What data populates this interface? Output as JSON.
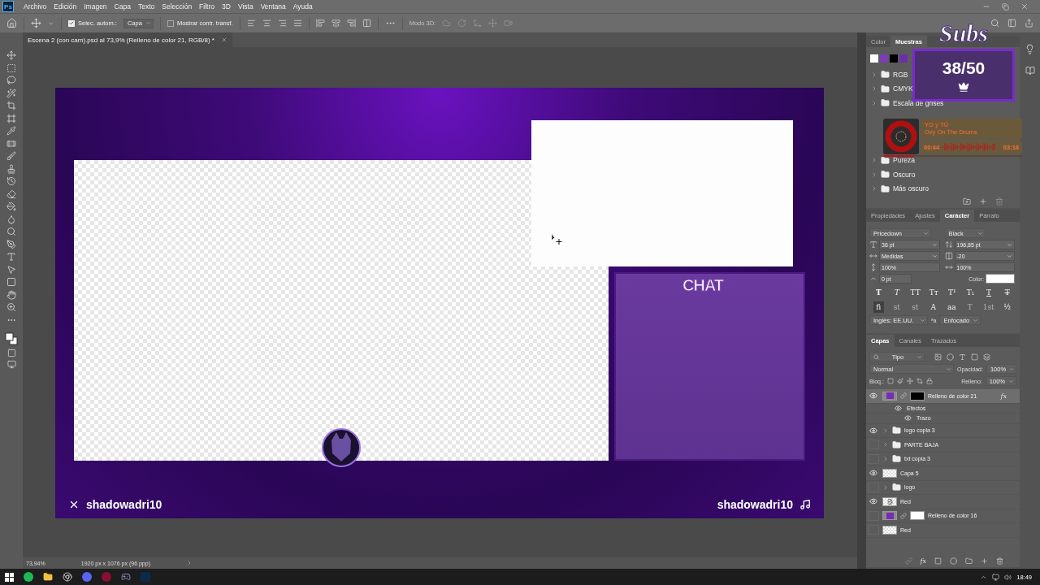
{
  "app_logo": "Ps",
  "menu": [
    "Archivo",
    "Edición",
    "Imagen",
    "Capa",
    "Texto",
    "Selección",
    "Filtro",
    "3D",
    "Vista",
    "Ventana",
    "Ayuda"
  ],
  "options_bar": {
    "auto_select": {
      "label": "Selec. autom.:",
      "checked": true
    },
    "target": "Capa",
    "show_transform": {
      "label": "Mostrar contr. transf.",
      "checked": false
    },
    "mode_3d": "Modo 3D:"
  },
  "document_tab": {
    "title": "Escena 2 (con cam).psd al 73,9% (Relleno de color 21, RGB/8) *",
    "selected": true
  },
  "canvas": {
    "chat_label": "CHAT",
    "left_handle": "shadowadri10",
    "right_handle": "shadowadri10"
  },
  "status_bar": {
    "zoom": "73,94%",
    "doc_size": "1920 px x 1076 px (96 ppp)"
  },
  "swatches_panel": {
    "tabs": [
      {
        "label": "Color",
        "selected": false
      },
      {
        "label": "Muestras",
        "selected": true
      }
    ],
    "swatches": [
      {
        "color": "#ffffff"
      },
      {
        "color": "#7b3db5"
      },
      {
        "color": "#000000"
      },
      {
        "color": "#6d2fa8"
      }
    ],
    "groups": [
      {
        "name": "RGB"
      },
      {
        "name": "CMYK"
      },
      {
        "name": "Escala de grises"
      },
      {
        "name": "Pureza"
      },
      {
        "name": "Oscuro"
      },
      {
        "name": "Más oscuro"
      }
    ]
  },
  "character_panel": {
    "tabs": [
      {
        "label": "Propiedades",
        "selected": false
      },
      {
        "label": "Ajustes",
        "selected": false
      },
      {
        "label": "Carácter",
        "selected": true
      },
      {
        "label": "Párrafo",
        "selected": false
      }
    ],
    "font": "Pricedown",
    "style": "Black",
    "size": "36 pt",
    "leading": "196,85 pt",
    "kerning": "Medidas",
    "tracking": "-20",
    "vertical_scale": "100%",
    "horizontal_scale": "100%",
    "baseline_shift": "0 pt",
    "color_label": "Color:",
    "style_buttons": [
      {
        "glyph": "T",
        "kind": "bold"
      },
      {
        "glyph": "T",
        "kind": "italic"
      },
      {
        "glyph": "TT",
        "kind": "caps"
      },
      {
        "glyph": "Tт",
        "kind": "smallcaps"
      },
      {
        "glyph": "T¹",
        "kind": "super"
      },
      {
        "glyph": "T₁",
        "kind": "sub"
      },
      {
        "glyph": "T",
        "kind": "underline"
      },
      {
        "glyph": "T",
        "kind": "strike"
      }
    ],
    "opentype_buttons": [
      {
        "glyph": "fi",
        "selected": true,
        "disabled": false
      },
      {
        "glyph": "st",
        "selected": false,
        "disabled": true
      },
      {
        "glyph": "st",
        "selected": false,
        "disabled": true
      },
      {
        "glyph": "A",
        "selected": false,
        "disabled": false
      },
      {
        "glyph": "aa",
        "selected": false,
        "disabled": false
      },
      {
        "glyph": "T",
        "selected": false,
        "disabled": true
      },
      {
        "glyph": "1st",
        "selected": false,
        "disabled": true
      },
      {
        "glyph": "½",
        "selected": false,
        "disabled": false
      }
    ],
    "language": "Inglés: EE.UU.",
    "aa_glyph": "ªa",
    "antialias": "Enfocado"
  },
  "layers_panel": {
    "tabs": [
      {
        "label": "Capas",
        "selected": true
      },
      {
        "label": "Canales",
        "selected": false
      },
      {
        "label": "Trazados",
        "selected": false
      }
    ],
    "filter": "Tipo",
    "blend_mode": "Normal",
    "opacity_label": "Opacidad:",
    "opacity": "100%",
    "lock_label": "Bloq.:",
    "fill_label": "Relleno:",
    "fill": "100%",
    "fx_button": "fx",
    "layers": [
      {
        "name": "Relleno de color 21",
        "kind": "fill",
        "visible": true,
        "selected": true,
        "fx_label": "fx",
        "mask_dark": true,
        "children": [
          {
            "name": "Efectos",
            "visible": true,
            "children": [
              {
                "name": "Trazo",
                "visible": true
              }
            ]
          }
        ]
      },
      {
        "name": "logo copia 3",
        "kind": "folder",
        "visible": true,
        "selected": false
      },
      {
        "name": "PARTE BAJA",
        "kind": "folder",
        "visible": false,
        "selected": false
      },
      {
        "name": "txt copia 3",
        "kind": "folder",
        "visible": false,
        "selected": false
      },
      {
        "name": "Capa 5",
        "kind": "layer",
        "visible": true,
        "selected": false
      },
      {
        "name": "logo",
        "kind": "folder",
        "visible": false,
        "selected": false
      },
      {
        "name": "Red",
        "kind": "smart",
        "visible": true,
        "selected": false
      },
      {
        "name": "Relleno de color 16",
        "kind": "fill",
        "visible": false,
        "selected": false,
        "mask_dark": false
      },
      {
        "name": "Red",
        "kind": "layer",
        "visible": false,
        "selected": false
      }
    ]
  },
  "taskbar": {
    "time": "18:49"
  },
  "overlays": {
    "subs": {
      "title": "Subs",
      "count": "38/50"
    },
    "music": {
      "title": "YO y TÚ",
      "artist": "Ovy On The Drums",
      "elapsed": "00:44",
      "total": "03:18",
      "level": 0.22
    }
  }
}
